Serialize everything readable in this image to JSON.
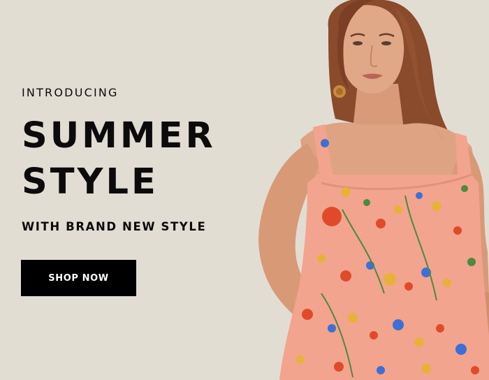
{
  "hero": {
    "eyebrow": "INTRODUCING",
    "headline_line1": "SUMMER",
    "headline_line2": "STYLE",
    "subhead": "WITH BRAND NEW STYLE",
    "cta_label": "SHOP NOW"
  },
  "colors": {
    "background": "#e2ddd3",
    "text": "#0b0b0b",
    "button": "#000000",
    "button_text": "#ffffff",
    "dress": "#f2a48e"
  },
  "image": {
    "subject": "model-photo"
  }
}
